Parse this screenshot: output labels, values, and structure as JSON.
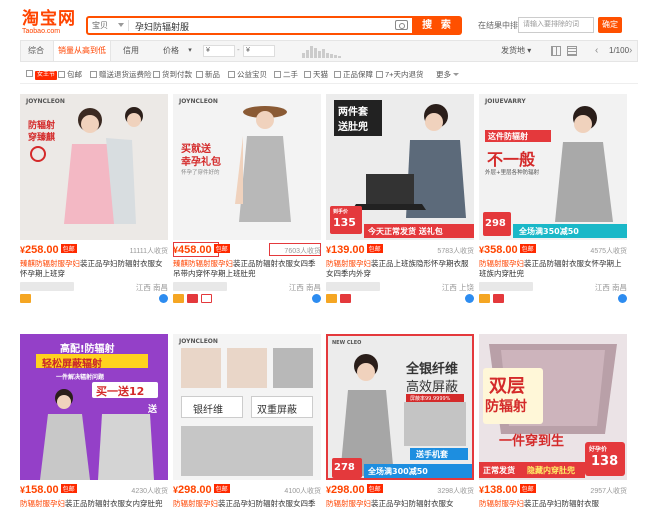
{
  "header": {
    "logo_text": "淘宝网",
    "logo_domain": "Taobao.com",
    "search_category": "宝贝",
    "search_query": "孕妇防辐射服",
    "search_button": "搜 索",
    "instore_label": "在结果中排除",
    "instore_placeholder": "请输入要排除的词",
    "confirm_button": "确定"
  },
  "sortbar": {
    "items": [
      "综合",
      "销量从高到低",
      "信用",
      "价格"
    ],
    "active_index": 1,
    "price_from": "¥",
    "price_to": "¥",
    "dash": "-",
    "shipping_label": "发货地",
    "page_info": "1/100",
    "prev": "‹",
    "next": "›"
  },
  "filters": {
    "items": [
      {
        "label": "女王节",
        "badge": true
      },
      {
        "label": "包邮"
      },
      {
        "label": "赠送退货运费险"
      },
      {
        "label": "货到付款"
      },
      {
        "label": "新品"
      },
      {
        "label": "公益宝贝"
      },
      {
        "label": "二手"
      },
      {
        "label": "天猫"
      },
      {
        "label": "正品保障"
      },
      {
        "label": "7+天内退货"
      },
      {
        "label": "更多"
      }
    ]
  },
  "products": [
    {
      "price": "258.00",
      "buyers": "11111人收货",
      "title_hl": "臻麒防辐射服孕妇",
      "title_rest": "装正品孕妇防辐射衣服女怀孕期上班穿",
      "location": "江西 南昌",
      "img_lines": [
        "JOYNCLEON",
        "防辐射",
        "穿臻麒"
      ]
    },
    {
      "price": "458.00",
      "buyers": "7603人收货",
      "title_hl": "臻麒防辐射服孕妇",
      "title_rest": "装正品防辐射衣服女四季吊带内穿怀孕期上班肚兜",
      "location": "江西 南昌",
      "img_lines": [
        "JOYNCLEON",
        "买就送",
        "幸孕礼包",
        "怀孕了穿件好的"
      ]
    },
    {
      "price": "139.00",
      "buyers": "5783人收货",
      "title_hl": "防辐射服孕妇",
      "title_rest": "装正品上班族隐形怀孕期衣服女四季内外穿",
      "location": "江西 上饶",
      "img_lines": [
        "两件套",
        "送肚兜",
        "到手价",
        "135",
        "今天正常发货 送礼包"
      ]
    },
    {
      "price": "358.00",
      "buyers": "4575人收货",
      "title_hl": "防辐射服孕妇",
      "title_rest": "装正品防辐射衣服女怀孕期上班族内穿肚兜",
      "location": "江西 南昌",
      "img_lines": [
        "JOIUEVARRY",
        "这件防辐射",
        "不一般",
        "外层+里层各种防辐射",
        "298",
        "全场满350减50"
      ]
    },
    {
      "price": "158.00",
      "buyers": "4230人收货",
      "title_hl": "防辐射服孕妇",
      "title_rest": "装正品防辐射衣服女内穿肚兜",
      "location": "",
      "img_lines": [
        "高配!防辐射",
        "轻松屏蔽辐射",
        "一件解决辐射问题",
        "买一送12",
        "送"
      ]
    },
    {
      "price": "298.00",
      "buyers": "4100人收货",
      "title_hl": "防辐射服孕妇",
      "title_rest": "装正品孕妇防辐射衣服女四季",
      "location": "",
      "img_lines": [
        "JOYNCLEON",
        "银纤维",
        "双重屏蔽"
      ]
    },
    {
      "price": "298.00",
      "buyers": "3298人收货",
      "title_hl": "防辐射服孕妇",
      "title_rest": "装正品孕妇防辐射衣服女",
      "location": "",
      "img_lines": [
        "NEW CLEO",
        "全银纤维",
        "高效屏蔽",
        "屏蔽率99.9999%",
        "送手机套",
        "278",
        "全场满300减50"
      ]
    },
    {
      "price": "138.00",
      "buyers": "2957人收货",
      "title_hl": "防辐射服孕妇",
      "title_rest": "装正品孕妇防辐射衣服",
      "location": "",
      "img_lines": [
        "双层",
        "防辐射",
        "一件穿到生",
        "好孕价",
        "138",
        "正常发货",
        "隐藏内穿肚兜"
      ]
    }
  ],
  "currency": "¥",
  "postage": "包邮"
}
